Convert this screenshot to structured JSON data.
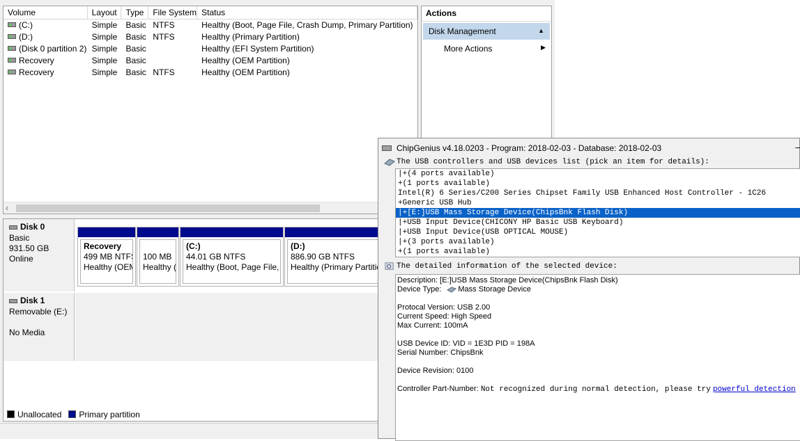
{
  "volumes": {
    "headers": [
      "Volume",
      "Layout",
      "Type",
      "File System",
      "Status"
    ],
    "rows": [
      {
        "volume": "(C:)",
        "layout": "Simple",
        "type": "Basic",
        "fs": "NTFS",
        "status": "Healthy (Boot, Page File, Crash Dump, Primary Partition)"
      },
      {
        "volume": "(D:)",
        "layout": "Simple",
        "type": "Basic",
        "fs": "NTFS",
        "status": "Healthy (Primary Partition)"
      },
      {
        "volume": "(Disk 0 partition 2)",
        "layout": "Simple",
        "type": "Basic",
        "fs": "",
        "status": "Healthy (EFI System Partition)"
      },
      {
        "volume": "Recovery",
        "layout": "Simple",
        "type": "Basic",
        "fs": "",
        "status": "Healthy (OEM Partition)"
      },
      {
        "volume": "Recovery",
        "layout": "Simple",
        "type": "Basic",
        "fs": "NTFS",
        "status": "Healthy (OEM Partition)"
      }
    ]
  },
  "actions": {
    "title": "Actions",
    "section": "Disk Management",
    "more": "More Actions"
  },
  "disks": {
    "disk0": {
      "name": "Disk 0",
      "type": "Basic",
      "size": "931.50 GB",
      "state": "Online"
    },
    "disk1": {
      "name": "Disk 1",
      "type": "Removable (E:)",
      "media": "No Media"
    },
    "partitions": [
      {
        "name": "Recovery",
        "size": "499 MB NTFS",
        "status": "Healthy (OEM"
      },
      {
        "name": "",
        "size": "100 MB",
        "status": "Healthy ("
      },
      {
        "name": "(C:)",
        "size": "44.01 GB NTFS",
        "status": "Healthy (Boot, Page File,"
      },
      {
        "name": "(D:)",
        "size": "886.90 GB NTFS",
        "status": "Healthy (Primary Partitio"
      }
    ]
  },
  "legend": {
    "unallocated": "Unallocated",
    "primary": "Primary partition"
  },
  "colors": {
    "primary_bar": "#000a8c",
    "selection": "#0a62c8",
    "actions_highlight": "#c3d7ec"
  },
  "chipgenius": {
    "title": "ChipGenius v4.18.0203 - Program: 2018-02-03 - Database: 2018-02-03",
    "list_label": "The USB controllers and USB devices list (pick an item for details):",
    "devices": [
      "|+(4 ports available)",
      "+(1 ports available)",
      "Intel(R) 6 Series/C200 Series Chipset Family USB Enhanced Host Controller - 1C26",
      "+Generic USB Hub",
      "|+[E:]USB Mass Storage Device(ChipsBnk Flash Disk)",
      "|+USB Input Device(CHICONY HP Basic USB Keyboard)",
      "|+USB Input Device(USB OPTICAL MOUSE)",
      "|+(3 ports available)",
      "+(1 ports available)"
    ],
    "selected_index": 4,
    "detail_label": "The detailed information of the selected device:",
    "detail": {
      "description": "Description: [E:]USB Mass Storage Device(ChipsBnk Flash Disk)",
      "device_type_label": "Device Type:",
      "device_type_value": "Mass Storage Device",
      "protocol": "Protocal Version: USB 2.00",
      "speed": "Current Speed: High Speed",
      "max_current": "Max Current: 100mA",
      "usb_id": "USB Device ID: VID = 1E3D PID = 198A",
      "serial": "Serial Number: ChipsBnk",
      "revision": "Device Revision: 0100",
      "controller_label": "Controller Part-Number:",
      "controller_text": "Not recognized during normal detection, please try",
      "controller_link": "powerful detection"
    }
  }
}
